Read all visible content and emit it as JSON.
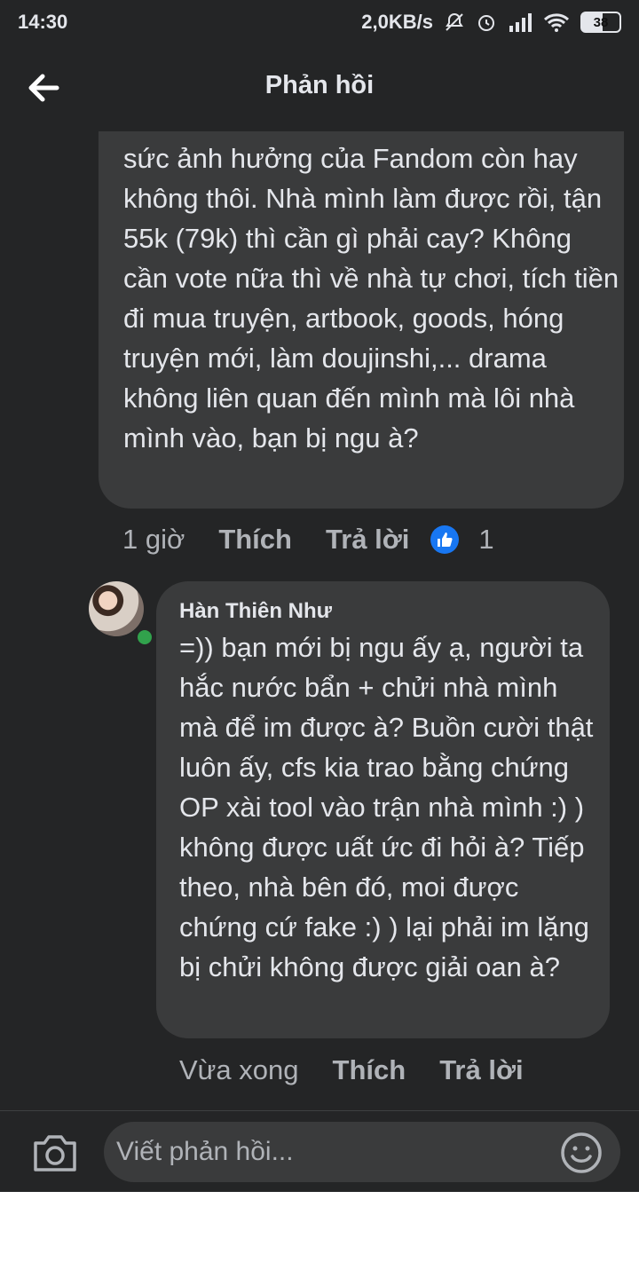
{
  "status_bar": {
    "time": "14:30",
    "network_speed": "2,0KB/s",
    "battery": "38"
  },
  "header": {
    "title": "Phản hồi"
  },
  "comments": [
    {
      "text": "sức ảnh hưởng của Fandom còn hay không thôi. Nhà mình làm được rồi, tận 55k (79k) thì cần gì phải cay? Không cần vote nữa thì về nhà tự chơi, tích tiền đi mua truyện, artbook, goods, hóng truyện mới, làm doujinshi,... drama không liên quan đến mình mà lôi nhà mình vào, bạn bị ngu à?",
      "time": "1 giờ",
      "like_label": "Thích",
      "reply_label": "Trả lời",
      "reaction_count": "1"
    },
    {
      "author": "Hàn Thiên Như",
      "text": "=)) bạn mới bị ngu ấy ạ, người ta hắc nước bẩn + chửi nhà mình mà để im được à? Buồn cười thật luôn ấy, cfs kia trao bằng chứng OP xài tool vào trận nhà mình :) ) không được uất ức đi hỏi à? Tiếp theo, nhà bên đó, moi được chứng cứ fake :) ) lại phải im lặng bị chửi không được giải oan à?",
      "time": "Vừa xong",
      "like_label": "Thích",
      "reply_label": "Trả lời"
    }
  ],
  "composer": {
    "placeholder": "Viết phản hồi..."
  },
  "colors": {
    "background": "#242526",
    "bubble": "#3a3b3c",
    "text": "#e4e6eb",
    "muted": "#b0b3b8",
    "like_blue": "#1877f2",
    "online_green": "#31a24c"
  }
}
